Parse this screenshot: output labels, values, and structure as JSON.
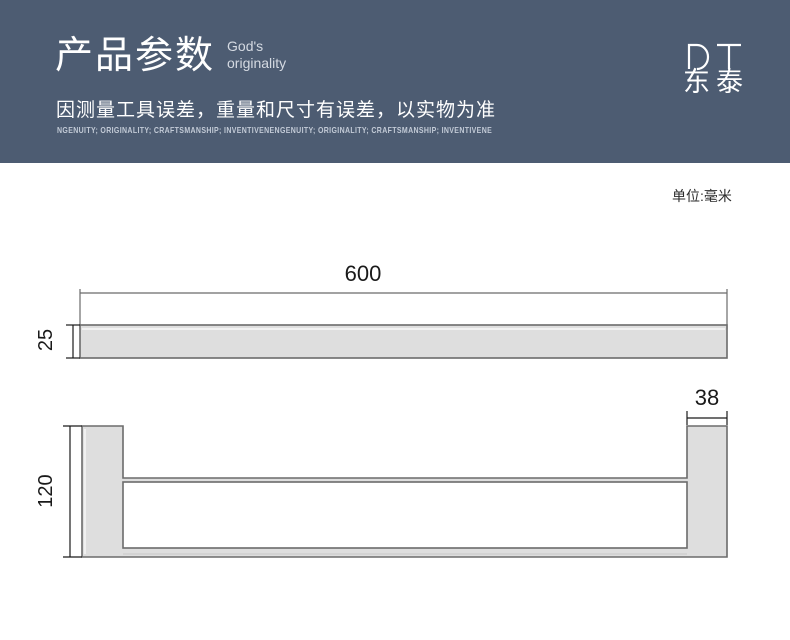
{
  "header": {
    "title_cn": "产品参数",
    "title_en_line1": "God's",
    "title_en_line2": "originality",
    "subtitle": "因测量工具误差，重量和尺寸有误差，以实物为准",
    "microtext": "NGENUITY; ORIGINALITY; CRAFTSMANSHIP; INVENTIVENENGENUITY; ORIGINALITY; CRAFTSMANSHIP; INVENTIVENE",
    "background_color": "#4d5c72"
  },
  "logo": {
    "mark": "DT",
    "name_cn": "东泰"
  },
  "drawing": {
    "unit_label": "单位:毫米",
    "line_color": "#6b6b6b",
    "fill_color": "#dedede",
    "dimensions": {
      "top_view_length": "600",
      "top_view_thickness": "25",
      "side_view_height": "120",
      "side_view_post_width": "38"
    }
  }
}
